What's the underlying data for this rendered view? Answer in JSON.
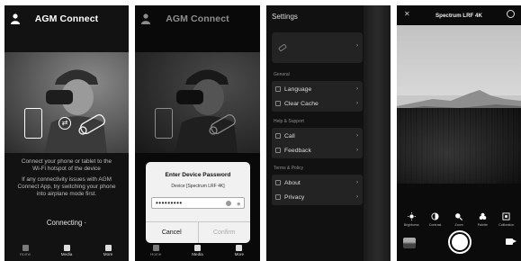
{
  "screen1": {
    "title": "AGM Connect",
    "message_primary": "Connect your phone or tablet to the Wi-Fi hotspot of the device",
    "message_secondary": "If any connectivity issues with AGM Connect App, try switching your phone into airplane mode first.",
    "status": "Connecting",
    "tabs": [
      "Home",
      "Media",
      "More"
    ]
  },
  "screen2": {
    "title": "AGM Connect",
    "dialog": {
      "title": "Enter Device Password",
      "subtitle": "Device [Spectrum LRF 4K]",
      "password_masked": "•••••••••",
      "cancel": "Cancel",
      "confirm": "Confirm"
    },
    "tabs": [
      "Home",
      "Media",
      "More"
    ]
  },
  "screen3": {
    "title": "Settings",
    "section_general": "General",
    "language": "Language",
    "clear_cache": "Clear Cache",
    "section_help": "Help & Support",
    "call": "Call",
    "feedback": "Feedback",
    "section_terms": "Terms & Policy",
    "about": "About",
    "privacy": "Privacy",
    "chevron": "›"
  },
  "screen4": {
    "title": "Spectrum LRF 4K",
    "close": "✕",
    "tools": [
      "Brightness",
      "Contrast",
      "Zoom",
      "Palette",
      "Calibration"
    ]
  }
}
